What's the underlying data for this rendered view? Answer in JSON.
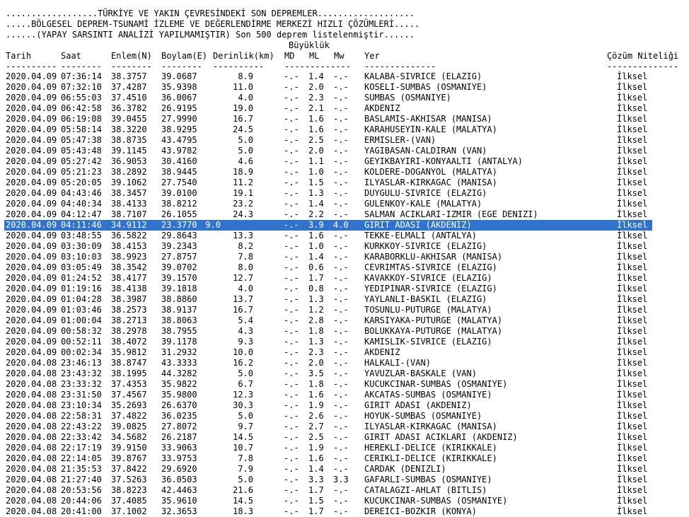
{
  "header": {
    "line1": "..................TÜRKİYE VE YAKIN ÇEVRESİNDEKİ SON DEPREMLER...................",
    "line2": ".....BÖLGESEL DEPREM-TSUNAMİ İZLEME VE DEĞERLENDİRME MERKEZİ HIZLI ÇÖZÜMLERİ.....",
    "line3": "......(YAPAY SARSINTI ANALİZİ YAPILMAMIŞTIR) Son 500 deprem listelenmiştir......"
  },
  "columns": {
    "group_magnitude": "Büyüklük",
    "tarih": "Tarih",
    "saat": "Saat",
    "enlem": "Enlem(N)",
    "boylam": "Boylam(E)",
    "derinlik": "Derinlik(km)",
    "md": "MD",
    "ml": "ML",
    "mw": "Mw",
    "yer": "Yer",
    "cozum": "Çözüm Niteliği"
  },
  "selected_index": 14,
  "selection_color": "#2f73cf",
  "rows": [
    {
      "tarih": "2020.04.09",
      "saat": "07:36:14",
      "enlem": "38.3757",
      "boylam": "39.0687",
      "derinlik": "8.9",
      "md": "-.-",
      "ml": "1.4",
      "mw": "-.-",
      "yer": "KALABA-SIVRICE (ELAZIG)",
      "cozum": "İlksel"
    },
    {
      "tarih": "2020.04.09",
      "saat": "07:32:10",
      "enlem": "37.4287",
      "boylam": "35.9398",
      "derinlik": "11.0",
      "md": "-.-",
      "ml": "2.0",
      "mw": "-.-",
      "yer": "KOSELI-SUMBAS (OSMANIYE)",
      "cozum": "İlksel"
    },
    {
      "tarih": "2020.04.09",
      "saat": "06:55:03",
      "enlem": "37.4510",
      "boylam": "36.0067",
      "derinlik": "4.0",
      "md": "-.-",
      "ml": "2.3",
      "mw": "-.-",
      "yer": "SUMBAS (OSMANIYE)",
      "cozum": "İlksel"
    },
    {
      "tarih": "2020.04.09",
      "saat": "06:42:58",
      "enlem": "36.3782",
      "boylam": "26.9195",
      "derinlik": "19.0",
      "md": "-.-",
      "ml": "2.1",
      "mw": "-.-",
      "yer": "AKDENIZ",
      "cozum": "İlksel"
    },
    {
      "tarih": "2020.04.09",
      "saat": "06:19:08",
      "enlem": "39.0455",
      "boylam": "27.9990",
      "derinlik": "16.7",
      "md": "-.-",
      "ml": "1.6",
      "mw": "-.-",
      "yer": "BASLAMIS-AKHISAR (MANISA)",
      "cozum": "İlksel"
    },
    {
      "tarih": "2020.04.09",
      "saat": "05:58:14",
      "enlem": "38.3220",
      "boylam": "38.9295",
      "derinlik": "24.5",
      "md": "-.-",
      "ml": "1.6",
      "mw": "-.-",
      "yer": "KARAHUSEYIN-KALE (MALATYA)",
      "cozum": "İlksel"
    },
    {
      "tarih": "2020.04.09",
      "saat": "05:47:38",
      "enlem": "38.8735",
      "boylam": "43.4795",
      "derinlik": "5.0",
      "md": "-.-",
      "ml": "2.5",
      "mw": "-.-",
      "yer": "ERMISLER-(VAN)",
      "cozum": "İlksel"
    },
    {
      "tarih": "2020.04.09",
      "saat": "05:43:48",
      "enlem": "39.1145",
      "boylam": "43.9782",
      "derinlik": "5.0",
      "md": "-.-",
      "ml": "2.0",
      "mw": "-.-",
      "yer": "YAGIBASAN-CALDIRAN (VAN)",
      "cozum": "İlksel"
    },
    {
      "tarih": "2020.04.09",
      "saat": "05:27:42",
      "enlem": "36.9053",
      "boylam": "30.4160",
      "derinlik": "4.6",
      "md": "-.-",
      "ml": "1.1",
      "mw": "-.-",
      "yer": "GEYIKBAYIRI-KONYAALTI (ANTALYA)",
      "cozum": "İlksel"
    },
    {
      "tarih": "2020.04.09",
      "saat": "05:21:23",
      "enlem": "38.2892",
      "boylam": "38.9445",
      "derinlik": "18.9",
      "md": "-.-",
      "ml": "1.0",
      "mw": "-.-",
      "yer": "KOLDERE-DOGANYOL (MALATYA)",
      "cozum": "İlksel"
    },
    {
      "tarih": "2020.04.09",
      "saat": "05:20:05",
      "enlem": "39.1062",
      "boylam": "27.7540",
      "derinlik": "11.2",
      "md": "-.-",
      "ml": "1.5",
      "mw": "-.-",
      "yer": "ILYASLAR-KIRKAGAC (MANISA)",
      "cozum": "İlksel"
    },
    {
      "tarih": "2020.04.09",
      "saat": "04:43:46",
      "enlem": "38.3457",
      "boylam": "39.0100",
      "derinlik": "19.1",
      "md": "-.-",
      "ml": "1.3",
      "mw": "-.-",
      "yer": "DUYGULU-SIVRICE (ELAZIG)",
      "cozum": "İlksel"
    },
    {
      "tarih": "2020.04.09",
      "saat": "04:40:34",
      "enlem": "38.4133",
      "boylam": "38.8212",
      "derinlik": "23.2",
      "md": "-.-",
      "ml": "1.4",
      "mw": "-.-",
      "yer": "GULENKOY-KALE (MALATYA)",
      "cozum": "İlksel"
    },
    {
      "tarih": "2020.04.09",
      "saat": "04:12:47",
      "enlem": "38.7107",
      "boylam": "26.1055",
      "derinlik": "24.3",
      "md": "-.-",
      "ml": "2.2",
      "mw": "-.-",
      "yer": "SALMAN ACIKLARI-IZMIR (EGE DENIZI)",
      "cozum": "İlksel"
    },
    {
      "tarih": "2020.04.09",
      "saat": "04:11:46",
      "enlem": "34.9112",
      "boylam": "23.3770",
      "derinlik": "9.0",
      "md": "-.-",
      "ml": "3.9",
      "mw": "4.0",
      "yer": "GIRIT ADASI (AKDENIZ)",
      "cozum": "İlksel"
    },
    {
      "tarih": "2020.04.09",
      "saat": "03:48:55",
      "enlem": "36.5822",
      "boylam": "29.8643",
      "derinlik": "13.3",
      "md": "-.-",
      "ml": "1.6",
      "mw": "-.-",
      "yer": "TEKKE-ELMALI (ANTALYA)",
      "cozum": "İlksel"
    },
    {
      "tarih": "2020.04.09",
      "saat": "03:30:09",
      "enlem": "38.4153",
      "boylam": "39.2343",
      "derinlik": "8.2",
      "md": "-.-",
      "ml": "1.0",
      "mw": "-.-",
      "yer": "KURKKOY-SIVRICE (ELAZIG)",
      "cozum": "İlksel"
    },
    {
      "tarih": "2020.04.09",
      "saat": "03:10:03",
      "enlem": "38.9923",
      "boylam": "27.8757",
      "derinlik": "7.8",
      "md": "-.-",
      "ml": "1.4",
      "mw": "-.-",
      "yer": "KARABORKLU-AKHISAR (MANISA)",
      "cozum": "İlksel"
    },
    {
      "tarih": "2020.04.09",
      "saat": "03:05:49",
      "enlem": "38.3542",
      "boylam": "39.0702",
      "derinlik": "8.0",
      "md": "-.-",
      "ml": "0.6",
      "mw": "-.-",
      "yer": "CEVRIMTAS-SIVRICE (ELAZIG)",
      "cozum": "İlksel"
    },
    {
      "tarih": "2020.04.09",
      "saat": "01:24:52",
      "enlem": "38.4177",
      "boylam": "39.1570",
      "derinlik": "12.7",
      "md": "-.-",
      "ml": "1.7",
      "mw": "-.-",
      "yer": "KAVAKKOY-SIVRICE (ELAZIG)",
      "cozum": "İlksel"
    },
    {
      "tarih": "2020.04.09",
      "saat": "01:19:16",
      "enlem": "38.4138",
      "boylam": "39.1818",
      "derinlik": "4.0",
      "md": "-.-",
      "ml": "0.8",
      "mw": "-.-",
      "yer": "YEDIPINAR-SIVRICE (ELAZIG)",
      "cozum": "İlksel"
    },
    {
      "tarih": "2020.04.09",
      "saat": "01:04:28",
      "enlem": "38.3987",
      "boylam": "38.8860",
      "derinlik": "13.7",
      "md": "-.-",
      "ml": "1.3",
      "mw": "-.-",
      "yer": "YAYLANLI-BASKIL (ELAZIG)",
      "cozum": "İlksel"
    },
    {
      "tarih": "2020.04.09",
      "saat": "01:03:46",
      "enlem": "38.2573",
      "boylam": "38.9137",
      "derinlik": "16.7",
      "md": "-.-",
      "ml": "1.2",
      "mw": "-.-",
      "yer": "TOSUNLU-PUTURGE (MALATYA)",
      "cozum": "İlksel"
    },
    {
      "tarih": "2020.04.09",
      "saat": "01:00:04",
      "enlem": "38.2713",
      "boylam": "38.8063",
      "derinlik": "5.4",
      "md": "-.-",
      "ml": "2.8",
      "mw": "-.-",
      "yer": "KARSIYAKA-PUTURGE (MALATYA)",
      "cozum": "İlksel"
    },
    {
      "tarih": "2020.04.09",
      "saat": "00:58:32",
      "enlem": "38.2978",
      "boylam": "38.7955",
      "derinlik": "4.3",
      "md": "-.-",
      "ml": "1.8",
      "mw": "-.-",
      "yer": "BOLUKKAYA-PUTURGE (MALATYA)",
      "cozum": "İlksel"
    },
    {
      "tarih": "2020.04.09",
      "saat": "00:52:11",
      "enlem": "38.4072",
      "boylam": "39.1178",
      "derinlik": "9.3",
      "md": "-.-",
      "ml": "1.3",
      "mw": "-.-",
      "yer": "KAMISLIK-SIVRICE (ELAZIG)",
      "cozum": "İlksel"
    },
    {
      "tarih": "2020.04.09",
      "saat": "00:02:34",
      "enlem": "35.9812",
      "boylam": "31.2932",
      "derinlik": "10.0",
      "md": "-.-",
      "ml": "2.3",
      "mw": "-.-",
      "yer": "AKDENIZ",
      "cozum": "İlksel"
    },
    {
      "tarih": "2020.04.08",
      "saat": "23:46:13",
      "enlem": "38.8747",
      "boylam": "43.3333",
      "derinlik": "16.2",
      "md": "-.-",
      "ml": "2.0",
      "mw": "-.-",
      "yer": "HALKALI-(VAN)",
      "cozum": "İlksel"
    },
    {
      "tarih": "2020.04.08",
      "saat": "23:43:32",
      "enlem": "38.1995",
      "boylam": "44.3282",
      "derinlik": "5.0",
      "md": "-.-",
      "ml": "3.5",
      "mw": "-.-",
      "yer": "YAVUZLAR-BASKALE (VAN)",
      "cozum": "İlksel"
    },
    {
      "tarih": "2020.04.08",
      "saat": "23:33:32",
      "enlem": "37.4353",
      "boylam": "35.9822",
      "derinlik": "6.7",
      "md": "-.-",
      "ml": "1.8",
      "mw": "-.-",
      "yer": "KUCUKCINAR-SUMBAS (OSMANIYE)",
      "cozum": "İlksel"
    },
    {
      "tarih": "2020.04.08",
      "saat": "23:31:50",
      "enlem": "37.4567",
      "boylam": "35.9800",
      "derinlik": "12.3",
      "md": "-.-",
      "ml": "1.6",
      "mw": "-.-",
      "yer": "AKCATAS-SUMBAS (OSMANIYE)",
      "cozum": "İlksel"
    },
    {
      "tarih": "2020.04.08",
      "saat": "23:10:34",
      "enlem": "35.2693",
      "boylam": "26.6370",
      "derinlik": "30.3",
      "md": "-.-",
      "ml": "1.9",
      "mw": "-.-",
      "yer": "GIRIT ADASI (AKDENIZ)",
      "cozum": "İlksel"
    },
    {
      "tarih": "2020.04.08",
      "saat": "22:58:31",
      "enlem": "37.4822",
      "boylam": "36.0235",
      "derinlik": "5.0",
      "md": "-.-",
      "ml": "2.6",
      "mw": "-.-",
      "yer": "HOYUK-SUMBAS (OSMANIYE)",
      "cozum": "İlksel"
    },
    {
      "tarih": "2020.04.08",
      "saat": "22:43:22",
      "enlem": "39.0825",
      "boylam": "27.8072",
      "derinlik": "9.7",
      "md": "-.-",
      "ml": "2.7",
      "mw": "-.-",
      "yer": "ILYASLAR-KIRKAGAC (MANISA)",
      "cozum": "İlksel"
    },
    {
      "tarih": "2020.04.08",
      "saat": "22:33:42",
      "enlem": "34.5682",
      "boylam": "26.2187",
      "derinlik": "14.5",
      "md": "-.-",
      "ml": "2.5",
      "mw": "-.-",
      "yer": "GIRIT ADASI ACIKLARI (AKDENIZ)",
      "cozum": "İlksel"
    },
    {
      "tarih": "2020.04.08",
      "saat": "22:17:19",
      "enlem": "39.9150",
      "boylam": "33.9063",
      "derinlik": "10.7",
      "md": "-.-",
      "ml": "1.9",
      "mw": "-.-",
      "yer": "HEREKLI-DELICE (KIRIKKALE)",
      "cozum": "İlksel"
    },
    {
      "tarih": "2020.04.08",
      "saat": "22:14:05",
      "enlem": "39.8767",
      "boylam": "33.9753",
      "derinlik": "7.8",
      "md": "-.-",
      "ml": "1.6",
      "mw": "-.-",
      "yer": "CERIKLI-DELICE (KIRIKKALE)",
      "cozum": "İlksel"
    },
    {
      "tarih": "2020.04.08",
      "saat": "21:35:53",
      "enlem": "37.8422",
      "boylam": "29.6920",
      "derinlik": "7.9",
      "md": "-.-",
      "ml": "1.4",
      "mw": "-.-",
      "yer": "CARDAK (DENIZLI)",
      "cozum": "İlksel"
    },
    {
      "tarih": "2020.04.08",
      "saat": "21:27:40",
      "enlem": "37.5263",
      "boylam": "36.0503",
      "derinlik": "5.0",
      "md": "-.-",
      "ml": "3.3",
      "mw": "3.3",
      "yer": "GAFARLI-SUMBAS (OSMANIYE)",
      "cozum": "İlksel"
    },
    {
      "tarih": "2020.04.08",
      "saat": "20:53:56",
      "enlem": "38.8223",
      "boylam": "42.4463",
      "derinlik": "21.6",
      "md": "-.-",
      "ml": "1.7",
      "mw": "-.-",
      "yer": "CATALAGZI-AHLAT (BITLIS)",
      "cozum": "İlksel"
    },
    {
      "tarih": "2020.04.08",
      "saat": "20:44:06",
      "enlem": "37.4085",
      "boylam": "35.9610",
      "derinlik": "14.5",
      "md": "-.-",
      "ml": "1.5",
      "mw": "-.-",
      "yer": "KUCUKCINAR-SUMBAS (OSMANIYE)",
      "cozum": "İlksel"
    },
    {
      "tarih": "2020.04.08",
      "saat": "20:41:00",
      "enlem": "37.1002",
      "boylam": "32.3653",
      "derinlik": "18.3",
      "md": "-.-",
      "ml": "1.7",
      "mw": "-.-",
      "yer": "DEREICI-BOZKIR (KONYA)",
      "cozum": "İlksel"
    }
  ]
}
